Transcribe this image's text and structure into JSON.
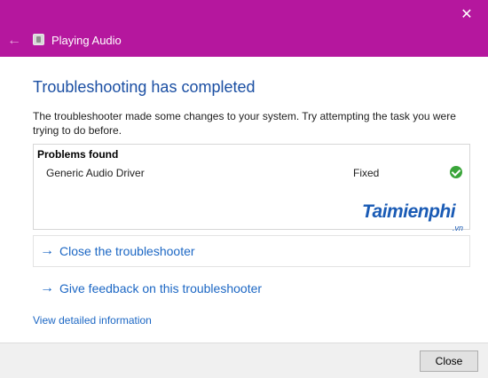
{
  "window": {
    "title": "Playing Audio",
    "close_glyph": "✕",
    "back_glyph": "←",
    "app_icon": "audio-troubleshooter-icon",
    "titlebar_color": "#b5179e"
  },
  "content": {
    "heading": "Troubleshooting has completed",
    "description": "The troubleshooter made some changes to your system. Try attempting the task you were trying to do before.",
    "problems": {
      "header": "Problems found",
      "items": [
        {
          "name": "Generic Audio Driver",
          "status": "Fixed",
          "status_icon": "check-icon",
          "status_color": "#3aa53a"
        }
      ]
    },
    "actions": [
      {
        "arrow": "→",
        "label": "Close the troubleshooter"
      },
      {
        "arrow": "→",
        "label": "Give feedback on this troubleshooter"
      }
    ],
    "details_link": "View detailed information"
  },
  "watermark": {
    "brand": "Taimienphi",
    "tld": ".vn"
  },
  "footer": {
    "close_label": "Close"
  },
  "colors": {
    "heading": "#1b4fa3",
    "link": "#1c67c4"
  }
}
